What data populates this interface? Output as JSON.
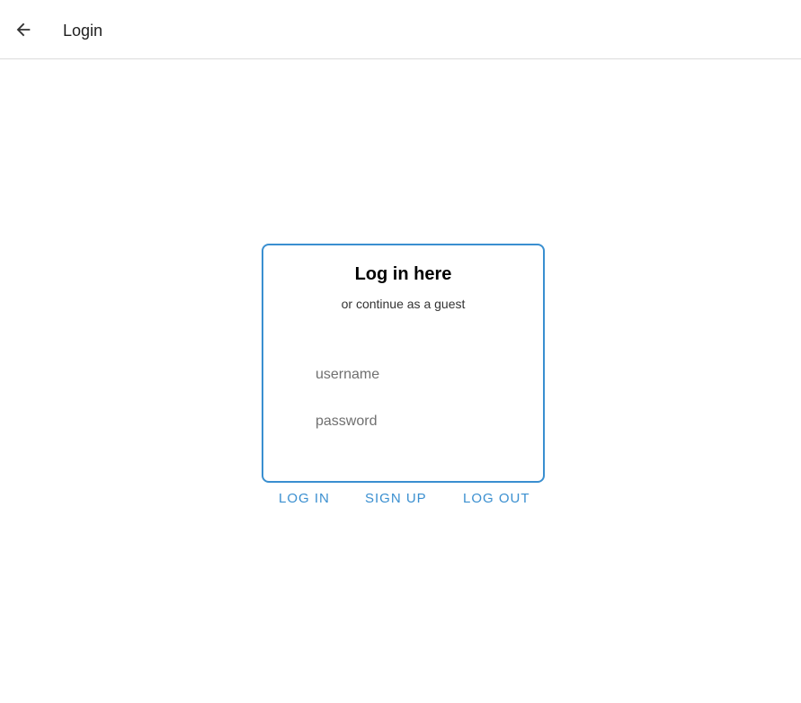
{
  "header": {
    "title": "Login",
    "back_icon": "arrow-left-icon"
  },
  "card": {
    "heading": "Log in here",
    "subtitle": "or continue as a guest",
    "border_color": "#3a8fd0",
    "username": {
      "placeholder": "username",
      "value": ""
    },
    "password": {
      "placeholder": "password",
      "value": ""
    }
  },
  "actions": {
    "login_label": "LOG IN",
    "signup_label": "SIGN UP",
    "logout_label": "LOG OUT",
    "accent_color": "#3a8fd0"
  }
}
